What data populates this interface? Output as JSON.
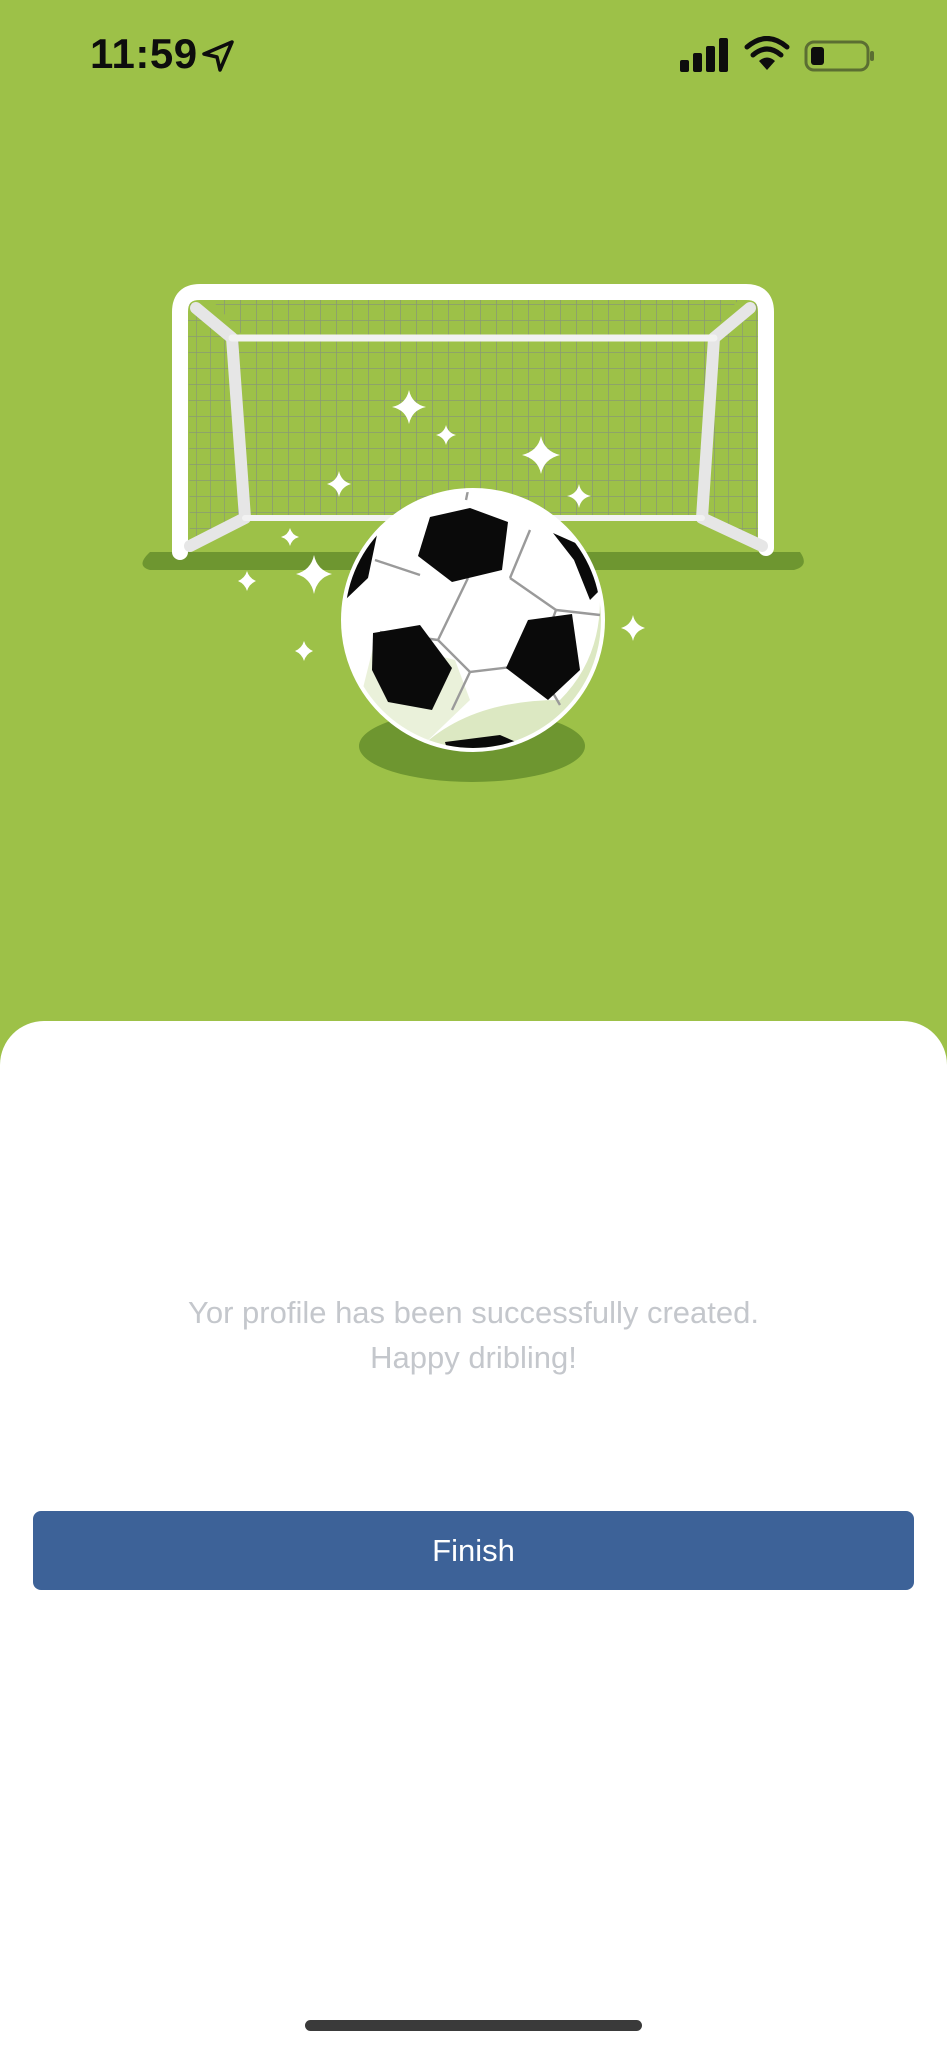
{
  "status_bar": {
    "time": "11:59",
    "icons": [
      "location-arrow-icon",
      "cellular-signal-icon",
      "wifi-icon",
      "battery-low-icon"
    ]
  },
  "hero": {
    "illustration": "soccer-ball-goal-illustration",
    "background_color": "#9dc148"
  },
  "message": {
    "line1": "Yor profile has been successfully created.",
    "line2": "Happy dribling!"
  },
  "actions": {
    "finish_label": "Finish"
  },
  "colors": {
    "accent": "#3d6298",
    "hero_green": "#9dc148",
    "muted_text": "#c4c7cc"
  }
}
